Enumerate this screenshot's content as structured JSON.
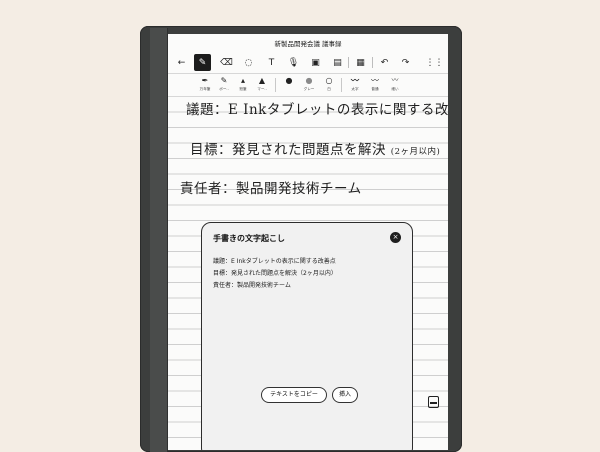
{
  "document": {
    "title": "新製品開発会議 議事録"
  },
  "toolbar": {
    "back_icon": "←",
    "pen_icon": "✎",
    "eraser_icon": "⌫",
    "lasso_icon": "◌",
    "text_icon": "T",
    "mic_icon": "🎙",
    "image_icon": "▣",
    "template_icon": "▤",
    "layers_icon": "▦",
    "undo_icon": "↶",
    "redo_icon": "↷",
    "more_icon": "⋮⋮"
  },
  "subtoolbar": {
    "tools": [
      {
        "glyph": "✒",
        "label": "万年筆"
      },
      {
        "glyph": "✎",
        "label": "ボー.."
      },
      {
        "glyph": "▴",
        "label": "鉛筆"
      },
      {
        "glyph": "▲",
        "label": "マー.."
      },
      {
        "glyph": "●",
        "label": ""
      },
      {
        "glyph": "●",
        "label": "グレー"
      },
      {
        "glyph": "○",
        "label": "白"
      },
      {
        "glyph": "〰",
        "label": "太字"
      },
      {
        "glyph": "〰",
        "label": "普通"
      },
      {
        "glyph": "〰",
        "label": "細い"
      }
    ]
  },
  "notes": {
    "line1": "議題：E Inkタブレットの表示に関する改善点",
    "line2": "目標：発見された問題点を解決",
    "line2_note": "(2ヶ月以内)",
    "line3": "責任者：製品開発技術チーム"
  },
  "popup": {
    "title": "手書きの文字起こし",
    "close_icon": "×",
    "lines": [
      "議題：E Inkタブレットの表示に関する改善点",
      "目標：発見された問題点を解決（2ヶ月以内）",
      "責任者：製品開発技術チーム"
    ],
    "copy_button": "テキストをコピー",
    "insert_button": "挿入"
  }
}
